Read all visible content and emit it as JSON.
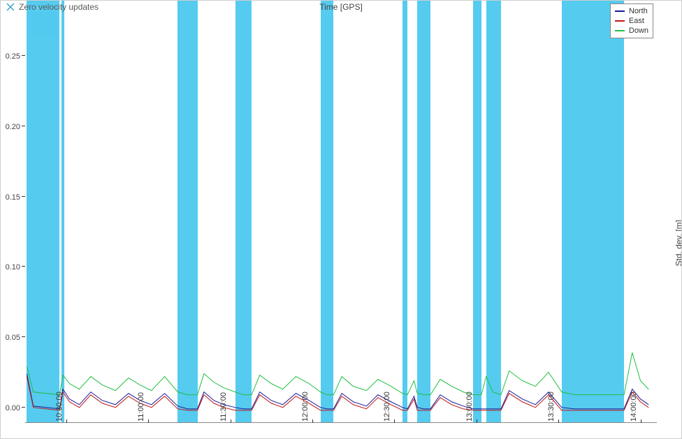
{
  "title_label": "Zero velocity updates",
  "x_title": "Time [GPS]",
  "y2_title": "Std. dev. [m]",
  "legend": [
    {
      "label": "North",
      "color": "#1a1a9a"
    },
    {
      "label": "East",
      "color": "#c01515"
    },
    {
      "label": "Down",
      "color": "#1fbf3f"
    }
  ],
  "y_axis": {
    "min": 0.0,
    "max": 0.3,
    "ticks": [
      0.0,
      0.05,
      0.1,
      0.15,
      0.2,
      0.25,
      0.3
    ],
    "tick_labels": [
      "0.00",
      "0.05",
      "0.10",
      "0.15",
      "0.20",
      "0.25"
    ]
  },
  "x_axis": {
    "min": 10.25,
    "max": 14.1,
    "ticks": [
      10.5,
      11.0,
      11.5,
      12.0,
      12.5,
      13.0,
      13.5,
      14.0
    ],
    "tick_labels": [
      "10:30:00",
      "11:00:00",
      "11:30:00",
      "12:00:00",
      "12:30:00",
      "13:00:00",
      "13:30:00",
      "14:00:00"
    ]
  },
  "colors": {
    "band": "#4cc8ee",
    "band_light": "#b6e8f8"
  },
  "chart_data": {
    "type": "line",
    "title": "Zero velocity updates",
    "xlabel": "Time [GPS]",
    "ylabel": "Std. dev. [m]",
    "xlim": [
      10.25,
      14.1
    ],
    "ylim": [
      0.0,
      0.3
    ],
    "bands": [
      {
        "x0": 10.26,
        "x1": 10.46,
        "style": "solid"
      },
      {
        "x0": 10.29,
        "x1": 10.44,
        "style": "light_overlay"
      },
      {
        "x0": 10.47,
        "x1": 10.49,
        "style": "solid"
      },
      {
        "x0": 11.18,
        "x1": 11.3,
        "style": "solid"
      },
      {
        "x0": 11.53,
        "x1": 11.63,
        "style": "solid"
      },
      {
        "x0": 12.05,
        "x1": 12.13,
        "style": "solid"
      },
      {
        "x0": 12.55,
        "x1": 12.58,
        "style": "solid"
      },
      {
        "x0": 12.64,
        "x1": 12.72,
        "style": "solid"
      },
      {
        "x0": 12.98,
        "x1": 13.03,
        "style": "solid"
      },
      {
        "x0": 13.06,
        "x1": 13.15,
        "style": "solid"
      },
      {
        "x0": 13.52,
        "x1": 13.9,
        "style": "solid"
      }
    ],
    "series": [
      {
        "name": "North",
        "color": "#1a1a9a",
        "x": [
          10.26,
          10.3,
          10.46,
          10.48,
          10.52,
          10.58,
          10.65,
          10.72,
          10.8,
          10.88,
          10.95,
          11.02,
          11.1,
          11.18,
          11.24,
          11.3,
          11.34,
          11.4,
          11.46,
          11.53,
          11.58,
          11.63,
          11.68,
          11.75,
          11.82,
          11.9,
          11.98,
          12.05,
          12.09,
          12.13,
          12.18,
          12.25,
          12.33,
          12.4,
          12.48,
          12.55,
          12.58,
          12.62,
          12.64,
          12.68,
          12.72,
          12.78,
          12.85,
          12.92,
          12.98,
          13.03,
          13.06,
          13.1,
          13.15,
          13.2,
          13.28,
          13.36,
          13.44,
          13.52,
          13.6,
          13.72,
          13.85,
          13.9,
          13.95,
          14.0,
          14.05
        ],
        "y": [
          0.035,
          0.012,
          0.01,
          0.024,
          0.017,
          0.013,
          0.022,
          0.016,
          0.013,
          0.021,
          0.016,
          0.013,
          0.021,
          0.012,
          0.01,
          0.01,
          0.022,
          0.016,
          0.013,
          0.011,
          0.01,
          0.01,
          0.022,
          0.016,
          0.013,
          0.021,
          0.016,
          0.011,
          0.01,
          0.01,
          0.021,
          0.015,
          0.012,
          0.02,
          0.015,
          0.011,
          0.01,
          0.019,
          0.011,
          0.01,
          0.01,
          0.02,
          0.015,
          0.012,
          0.01,
          0.01,
          0.01,
          0.01,
          0.01,
          0.023,
          0.017,
          0.013,
          0.022,
          0.011,
          0.01,
          0.01,
          0.01,
          0.01,
          0.024,
          0.017,
          0.013
        ]
      },
      {
        "name": "East",
        "color": "#c01515",
        "x": [
          10.26,
          10.3,
          10.46,
          10.48,
          10.52,
          10.58,
          10.65,
          10.72,
          10.8,
          10.88,
          10.95,
          11.02,
          11.1,
          11.18,
          11.24,
          11.3,
          11.34,
          11.4,
          11.46,
          11.53,
          11.58,
          11.63,
          11.68,
          11.75,
          11.82,
          11.9,
          11.98,
          12.05,
          12.09,
          12.13,
          12.18,
          12.25,
          12.33,
          12.4,
          12.48,
          12.55,
          12.58,
          12.62,
          12.64,
          12.68,
          12.72,
          12.78,
          12.85,
          12.92,
          12.98,
          13.03,
          13.06,
          13.1,
          13.15,
          13.2,
          13.28,
          13.36,
          13.44,
          13.52,
          13.6,
          13.72,
          13.85,
          13.9,
          13.95,
          14.0,
          14.05
        ],
        "y": [
          0.033,
          0.011,
          0.009,
          0.022,
          0.015,
          0.011,
          0.02,
          0.014,
          0.011,
          0.019,
          0.014,
          0.011,
          0.019,
          0.01,
          0.009,
          0.009,
          0.02,
          0.014,
          0.011,
          0.009,
          0.009,
          0.009,
          0.02,
          0.014,
          0.011,
          0.019,
          0.014,
          0.009,
          0.009,
          0.009,
          0.019,
          0.013,
          0.01,
          0.018,
          0.013,
          0.009,
          0.009,
          0.017,
          0.009,
          0.009,
          0.009,
          0.018,
          0.013,
          0.01,
          0.009,
          0.009,
          0.009,
          0.009,
          0.009,
          0.021,
          0.015,
          0.011,
          0.02,
          0.009,
          0.009,
          0.009,
          0.009,
          0.009,
          0.022,
          0.015,
          0.011
        ]
      },
      {
        "name": "Down",
        "color": "#1fbf3f",
        "x": [
          10.26,
          10.3,
          10.46,
          10.48,
          10.52,
          10.58,
          10.65,
          10.72,
          10.8,
          10.88,
          10.95,
          11.02,
          11.1,
          11.18,
          11.24,
          11.3,
          11.34,
          11.4,
          11.46,
          11.53,
          11.58,
          11.63,
          11.68,
          11.75,
          11.82,
          11.9,
          11.98,
          12.05,
          12.09,
          12.13,
          12.18,
          12.25,
          12.33,
          12.4,
          12.48,
          12.55,
          12.58,
          12.62,
          12.64,
          12.68,
          12.72,
          12.78,
          12.85,
          12.92,
          12.98,
          13.03,
          13.06,
          13.1,
          13.15,
          13.2,
          13.28,
          13.36,
          13.44,
          13.52,
          13.6,
          13.72,
          13.85,
          13.9,
          13.95,
          14.0,
          14.05
        ],
        "y": [
          0.04,
          0.022,
          0.02,
          0.034,
          0.028,
          0.024,
          0.033,
          0.027,
          0.023,
          0.032,
          0.027,
          0.023,
          0.033,
          0.022,
          0.02,
          0.02,
          0.035,
          0.029,
          0.025,
          0.022,
          0.02,
          0.02,
          0.034,
          0.028,
          0.024,
          0.033,
          0.028,
          0.022,
          0.02,
          0.02,
          0.033,
          0.026,
          0.023,
          0.031,
          0.026,
          0.021,
          0.02,
          0.03,
          0.021,
          0.02,
          0.02,
          0.031,
          0.026,
          0.022,
          0.02,
          0.02,
          0.033,
          0.022,
          0.02,
          0.037,
          0.03,
          0.026,
          0.036,
          0.022,
          0.02,
          0.02,
          0.02,
          0.02,
          0.05,
          0.03,
          0.024
        ]
      }
    ]
  }
}
